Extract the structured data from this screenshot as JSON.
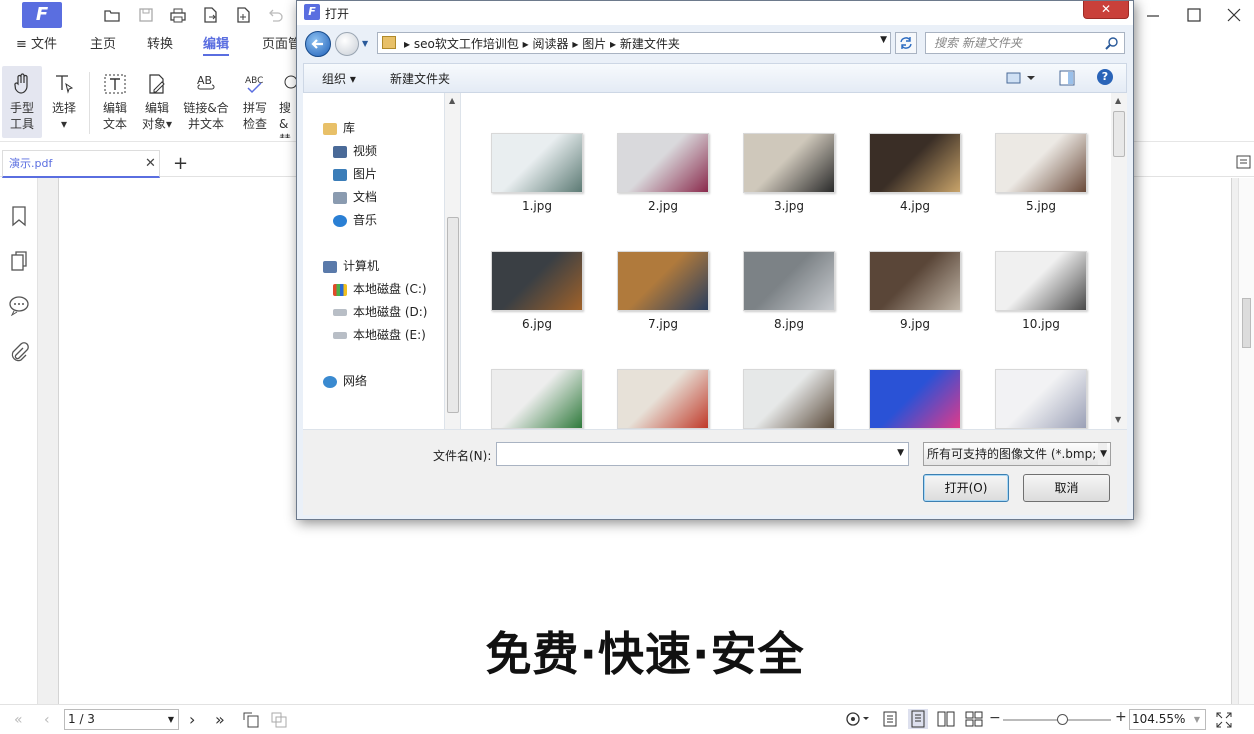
{
  "app": {
    "quick_access_icons": [
      "open-folder-icon",
      "save-icon",
      "print-icon",
      "export-icon",
      "new-icon",
      "undo-icon"
    ],
    "ribbon_tabs": [
      {
        "label": "≡ 文件",
        "active": false
      },
      {
        "label": "主页",
        "active": false
      },
      {
        "label": "转换",
        "active": false
      },
      {
        "label": "编辑",
        "active": true
      },
      {
        "label": "页面管",
        "active": false
      }
    ],
    "ribbon_buttons": [
      {
        "label1": "手型",
        "label2": "工具",
        "icon": "hand-icon"
      },
      {
        "label1": "选择",
        "label2": "▾",
        "icon": "select-text-icon"
      },
      {
        "label1": "编辑",
        "label2": "文本",
        "icon": "edit-text-icon"
      },
      {
        "label1": "编辑",
        "label2": "对象▾",
        "icon": "edit-object-icon"
      },
      {
        "label1": "链接&合",
        "label2": "并文本",
        "icon": "link-merge-text-icon"
      },
      {
        "label1": "拼写",
        "label2": "检查",
        "icon": "spell-check-icon"
      },
      {
        "label1": "搜",
        "label2": "&替",
        "icon": "search-replace-icon"
      }
    ],
    "doc_tab": {
      "name": "演示.pdf"
    },
    "new_tab": "+",
    "left_panel_icons": [
      "bookmark-icon",
      "pages-icon",
      "comment-icon",
      "attachment-icon"
    ],
    "page_slogan": "免费·快速·安全",
    "status": {
      "page_input": "1 / 3",
      "zoom": "104.55%",
      "zoom_fraction": 0.55
    }
  },
  "dialog": {
    "title": "打开",
    "close_label": "✕",
    "address_crumbs": [
      "seo软文工作培训包",
      "阅读器",
      "图片",
      "新建文件夹"
    ],
    "search_placeholder": "搜索 新建文件夹",
    "toolbar": {
      "organize": "组织 ▾",
      "new_folder": "新建文件夹"
    },
    "nav": {
      "library_label": "库",
      "library_items": [
        {
          "label": "视频",
          "icon": "video-icon",
          "color": "#4a6a98"
        },
        {
          "label": "图片",
          "icon": "picture-icon",
          "color": "#3b7db8"
        },
        {
          "label": "文档",
          "icon": "document-icon",
          "color": "#8a9bb0"
        },
        {
          "label": "音乐",
          "icon": "music-icon",
          "color": "#2a7fd4"
        }
      ],
      "computer_label": "计算机",
      "drives": [
        {
          "label": "本地磁盘 (C:)",
          "icon": "windows-drive-icon"
        },
        {
          "label": "本地磁盘 (D:)",
          "icon": "drive-icon"
        },
        {
          "label": "本地磁盘 (E:)",
          "icon": "drive-icon"
        }
      ],
      "network_label": "网络"
    },
    "files": [
      {
        "name": "1.jpg",
        "c1": "#e9eef0",
        "c2": "#5c7a74"
      },
      {
        "name": "2.jpg",
        "c1": "#d9d9dc",
        "c2": "#8a2a4c"
      },
      {
        "name": "3.jpg",
        "c1": "#cfc8bb",
        "c2": "#2a2a2a"
      },
      {
        "name": "4.jpg",
        "c1": "#3a2e26",
        "c2": "#c9a46a"
      },
      {
        "name": "5.jpg",
        "c1": "#ece9e4",
        "c2": "#6a4a3a"
      },
      {
        "name": "6.jpg",
        "c1": "#3a3f44",
        "c2": "#a0622a"
      },
      {
        "name": "7.jpg",
        "c1": "#b07a3c",
        "c2": "#2a3e5e"
      },
      {
        "name": "8.jpg",
        "c1": "#7c8286",
        "c2": "#c9ccd0"
      },
      {
        "name": "9.jpg",
        "c1": "#5a4638",
        "c2": "#c1b6a8"
      },
      {
        "name": "10.jpg",
        "c1": "#f0f0f0",
        "c2": "#4a4a4a"
      },
      {
        "name": "",
        "c1": "#ededed",
        "c2": "#2f7a3c"
      },
      {
        "name": "",
        "c1": "#e7e1d8",
        "c2": "#c03a2a"
      },
      {
        "name": "",
        "c1": "#e6e8e8",
        "c2": "#5a4a3a"
      },
      {
        "name": "",
        "c1": "#2a52d6",
        "c2": "#e03a8a"
      },
      {
        "name": "",
        "c1": "#f2f2f4",
        "c2": "#9aa0b6"
      }
    ],
    "filename_label": "文件名(N):",
    "filename_value": "",
    "filetype": "所有可支持的图像文件 (*.bmp;",
    "open_label": "打开(O)",
    "cancel_label": "取消"
  }
}
